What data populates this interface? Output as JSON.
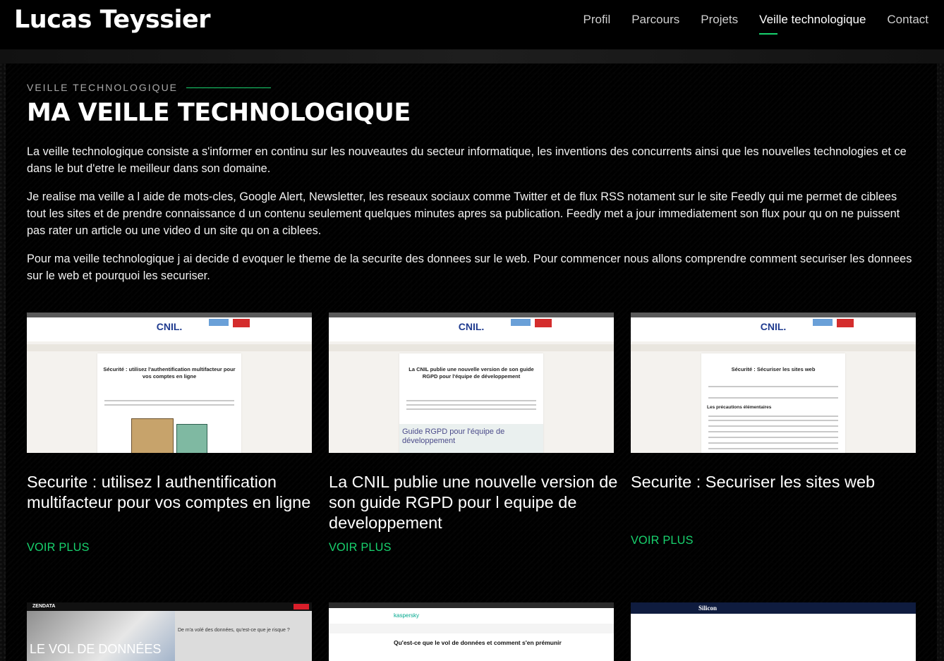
{
  "header": {
    "logo": "Lucas Teyssier",
    "nav": [
      "Profil",
      "Parcours",
      "Projets",
      "Veille technologique",
      "Contact"
    ],
    "active_index": 3
  },
  "section": {
    "kicker": "VEILLE TECHNOLOGIQUE",
    "title": "MA VEILLE TECHNOLOGIQUE",
    "paragraphs": [
      "La veille technologique consiste a s'informer en continu sur les nouveautes du secteur informatique, les inventions des concurrents ainsi que les nouvelles technologies et ce dans le but d'etre le meilleur dans son domaine.",
      "Je realise ma veille a l aide de mots-cles, Google Alert, Newsletter, les reseaux sociaux comme Twitter et de flux RSS notament sur le site Feedly qui me permet de ciblees tout les sites et de prendre connaissance d un contenu seulement quelques minutes apres sa publication. Feedly met a jour immediatement son flux pour qu on ne puissent pas rater un article ou une video d un site qu on a ciblees.",
      "Pour ma veille technologique j ai decide d evoquer le theme de la securite des donnees sur le web. Pour commencer nous allons comprendre comment securiser les donnees sur le web et pourquoi les securiser."
    ]
  },
  "cards": [
    {
      "title": "Securite : utilisez l authentification multifacteur pour vos comptes en ligne",
      "more": "VOIR PLUS",
      "thumb": {
        "site": "CNIL.",
        "heading": "Sécurité : utilisez l'authentification multifacteur pour vos comptes en ligne"
      }
    },
    {
      "title": "La CNIL publie une nouvelle version de son guide RGPD pour l equipe de developpement",
      "more": "VOIR PLUS",
      "thumb": {
        "site": "CNIL.",
        "heading": "La CNIL publie une nouvelle version de son guide RGPD pour l'équipe de développement",
        "banner": "Guide RGPD pour l'équipe de développement"
      }
    },
    {
      "title": "Securite : Securiser les sites web",
      "more": "VOIR PLUS",
      "thumb": {
        "site": "CNIL.",
        "heading": "Sécurité : Sécuriser les sites web",
        "subheading": "Les précautions élémentaires"
      }
    }
  ],
  "bottom_thumbs": [
    {
      "site": "ZENDATA",
      "headline": "LE VOL DE DONNÉES",
      "sub": "De m'a volé des données, qu'est-ce que je risque ?"
    },
    {
      "site": "kaspersky",
      "headline": "Qu'est-ce que le vol de données et comment s'en prémunir"
    },
    {
      "site": "Silicon"
    }
  ],
  "colors": {
    "accent": "#18d26e",
    "background": "#0b0b0b"
  }
}
